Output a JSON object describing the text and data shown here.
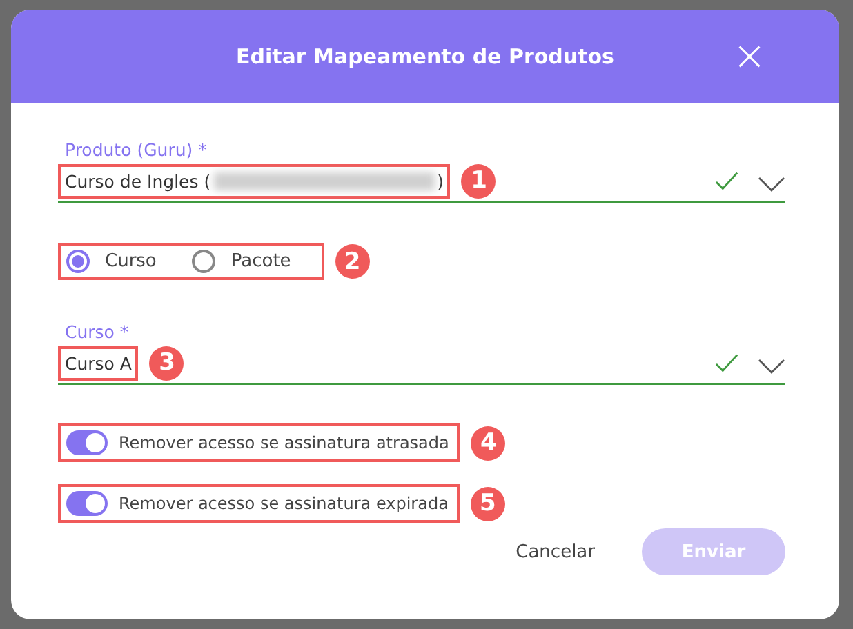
{
  "dialog": {
    "title": "Editar Mapeamento de Produtos"
  },
  "product_field": {
    "label": "Produto (Guru) *",
    "value_prefix": "Curso de Ingles (",
    "value_suffix": ")",
    "redacted": true,
    "valid": true,
    "annotation": "1"
  },
  "type_options": {
    "annotation": "2",
    "options": [
      {
        "label": "Curso",
        "selected": true
      },
      {
        "label": "Pacote",
        "selected": false
      }
    ]
  },
  "course_field": {
    "label": "Curso *",
    "value": "Curso A",
    "valid": true,
    "annotation": "3"
  },
  "toggles": [
    {
      "label": "Remover acesso se assinatura atrasada",
      "on": true,
      "annotation": "4"
    },
    {
      "label": "Remover acesso se assinatura expirada",
      "on": true,
      "annotation": "5"
    }
  ],
  "buttons": [
    {
      "label": "Cancelar",
      "kind": "text",
      "disabled": false
    },
    {
      "label": "Enviar",
      "kind": "primary",
      "disabled": true
    }
  ]
}
